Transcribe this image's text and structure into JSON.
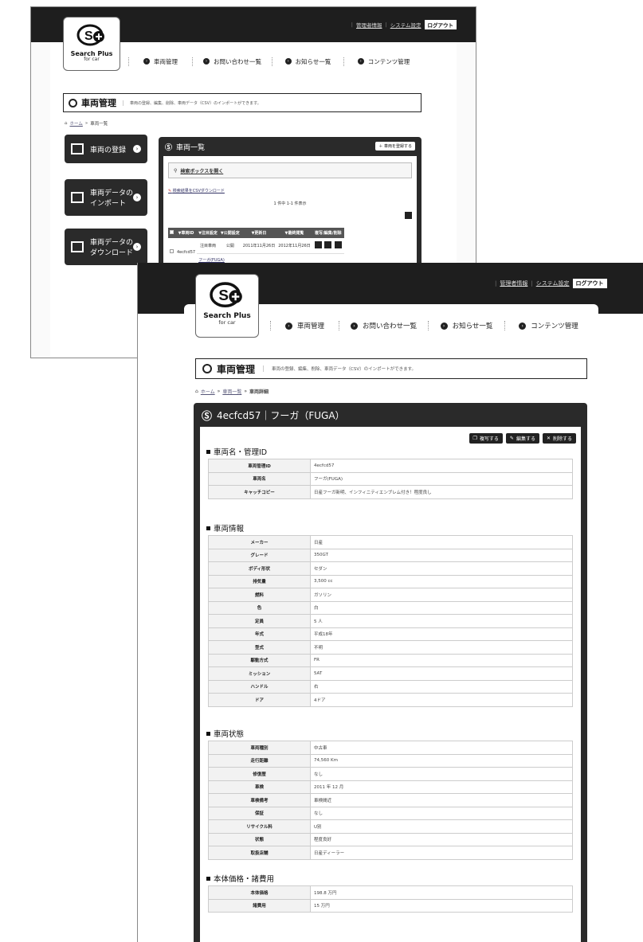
{
  "header": {
    "links": [
      "管理者情報",
      "システム設定"
    ],
    "logout_label": "ログアウト",
    "brand": "Search Plus",
    "brand_sub": "for car"
  },
  "nav": [
    {
      "label": "車両管理"
    },
    {
      "label": "お問い合わせ一覧"
    },
    {
      "label": "お知らせ一覧"
    },
    {
      "label": "コンテンツ管理"
    }
  ],
  "page": {
    "title": "車両管理",
    "description": "車両の登録、編集、削除、車両データ（CSV）のインポートができます。"
  },
  "back": {
    "breadcrumb": [
      "ホーム",
      "車両一覧"
    ],
    "sidebar": [
      {
        "label": "車両の登録"
      },
      {
        "label": "車両データの インポート"
      },
      {
        "label": "車両データの ダウンロード"
      }
    ],
    "panel_title": "車両一覧",
    "register_button": "車両を登録する",
    "search_toggle": "検索ボックスを開く",
    "csv_download": "検索結果をCSVダウンロード",
    "count_text": "1 件中 1-1 件表示",
    "table_headers": [
      "",
      "▼車両ID",
      "▼注目設定",
      "▼公開設定",
      "▼更新日",
      "▼最終閲覧",
      "複写/編集/削除"
    ],
    "rows": [
      {
        "id": "4ecfcd57",
        "featured": "注目車両",
        "public": "公開",
        "updated": "2011年11月26日",
        "viewed": "2012年11月26日",
        "name_link": "フーガ(FUGA)"
      }
    ]
  },
  "front": {
    "breadcrumb": [
      "ホーム",
      "車両一覧",
      "車両詳細"
    ],
    "vehicle_title": "4ecfcd57｜フーガ（FUGA）",
    "actions": [
      "複写する",
      "編集する",
      "削除する"
    ],
    "sections": [
      {
        "title": "車両名・管理ID",
        "rows": [
          {
            "k": "車両管理ID",
            "v": "4ecfcd57"
          },
          {
            "k": "車両名",
            "v": "フーガ(FUGA)"
          },
          {
            "k": "キャッチコピー",
            "v": "日産フーガ新明、インフィニティエンブレム付き！程度良し"
          }
        ]
      },
      {
        "title": "車両情報",
        "rows": [
          {
            "k": "メーカー",
            "v": "日産"
          },
          {
            "k": "グレード",
            "v": "350GT"
          },
          {
            "k": "ボディ形状",
            "v": "セダン"
          },
          {
            "k": "排気量",
            "v": "3,500 cc"
          },
          {
            "k": "燃料",
            "v": "ガソリン"
          },
          {
            "k": "色",
            "v": "白"
          },
          {
            "k": "定員",
            "v": "5 人"
          },
          {
            "k": "年式",
            "v": "平成18年"
          },
          {
            "k": "型式",
            "v": "不明"
          },
          {
            "k": "駆動方式",
            "v": "FR"
          },
          {
            "k": "ミッション",
            "v": "5AT"
          },
          {
            "k": "ハンドル",
            "v": "右"
          },
          {
            "k": "ドア",
            "v": "4ドア"
          }
        ]
      },
      {
        "title": "車両状態",
        "rows": [
          {
            "k": "車両種別",
            "v": "中古車"
          },
          {
            "k": "走行距離",
            "v": "74,560 Km"
          },
          {
            "k": "修復歴",
            "v": "なし"
          },
          {
            "k": "車検",
            "v": "2011 年 12 月"
          },
          {
            "k": "車検備考",
            "v": "車検間近"
          },
          {
            "k": "保証",
            "v": "なし"
          },
          {
            "k": "リサイクル料",
            "v": "U別"
          },
          {
            "k": "状態",
            "v": "程度良好"
          },
          {
            "k": "取扱店舗",
            "v": "日産ディーラー"
          }
        ]
      },
      {
        "title": "本体価格・諸費用",
        "rows": [
          {
            "k": "本体価格",
            "v": "198.8 万円"
          },
          {
            "k": "諸費用",
            "v": "15 万円"
          }
        ]
      }
    ]
  }
}
